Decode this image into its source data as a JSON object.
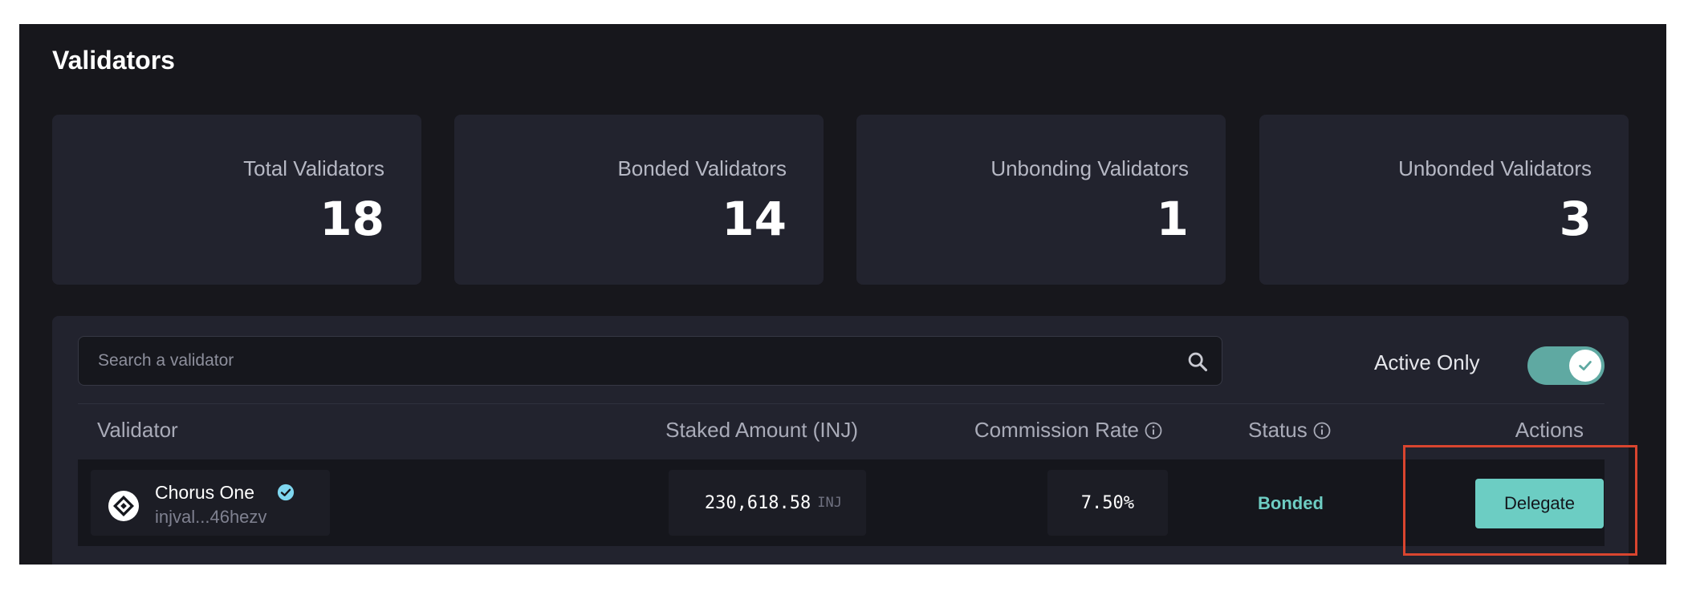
{
  "page": {
    "title": "Validators"
  },
  "stats": [
    {
      "label": "Total Validators",
      "value": "18"
    },
    {
      "label": "Bonded Validators",
      "value": "14"
    },
    {
      "label": "Unbonding Validators",
      "value": "1"
    },
    {
      "label": "Unbonded Validators",
      "value": "3"
    }
  ],
  "search": {
    "placeholder": "Search a validator",
    "value": ""
  },
  "filter": {
    "label": "Active Only",
    "enabled": true
  },
  "table": {
    "headers": {
      "validator": "Validator",
      "staked": "Staked Amount (INJ)",
      "commission": "Commission Rate",
      "status": "Status",
      "actions": "Actions"
    },
    "rows": [
      {
        "name": "Chorus One",
        "verified": true,
        "address": "injval...46hezv",
        "staked_amount": "230,618.58",
        "staked_unit": "INJ",
        "commission_rate": "7.50%",
        "status": "Bonded",
        "action_label": "Delegate"
      }
    ]
  },
  "colors": {
    "background": "#17171c",
    "card": "#22232e",
    "accent": "#6ccdc3",
    "status_bonded": "#6ecdc3",
    "highlight": "#d9452f"
  },
  "icons": {
    "search": "search-icon",
    "toggle_check": "check-icon",
    "info": "info-icon",
    "verified": "verified-badge-icon",
    "validator_logo": "chorus-one-logo-icon"
  }
}
